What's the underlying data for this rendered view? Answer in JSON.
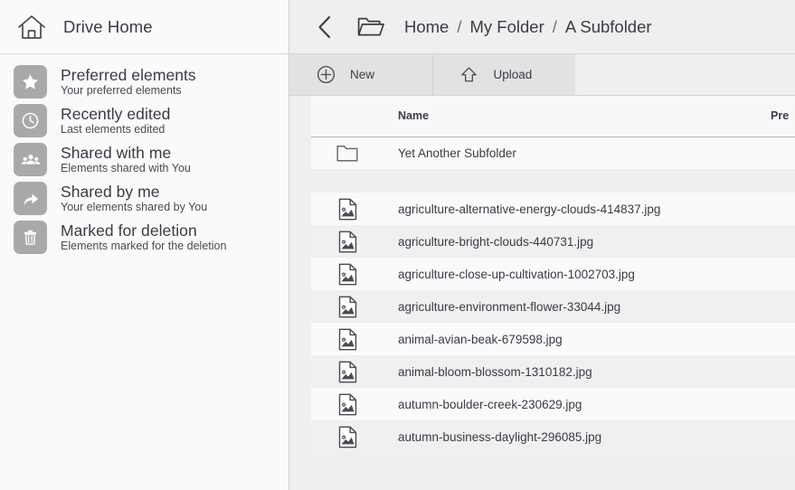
{
  "sidebar": {
    "home": {
      "label": "Drive Home",
      "icon": "home-icon"
    },
    "items": [
      {
        "icon": "star-icon",
        "title": "Preferred elements",
        "subtitle": "Your preferred elements"
      },
      {
        "icon": "clock-icon",
        "title": "Recently edited",
        "subtitle": "Last elements edited"
      },
      {
        "icon": "people-icon",
        "title": "Shared with me",
        "subtitle": "Elements shared with You"
      },
      {
        "icon": "share-arrow-icon",
        "title": "Shared by me",
        "subtitle": "Your elements shared by You"
      },
      {
        "icon": "trash-icon",
        "title": "Marked for deletion",
        "subtitle": "Elements marked for the deletion"
      }
    ]
  },
  "header": {
    "back_icon": "chevron-left-icon",
    "folder_icon": "folder-open-icon",
    "breadcrumbs": [
      "Home",
      "My Folder",
      "A Subfolder"
    ],
    "separator": "/"
  },
  "toolbar": {
    "buttons": [
      {
        "label": "New",
        "icon": "plus-circle-icon"
      },
      {
        "label": "Upload",
        "icon": "upload-arrow-icon"
      }
    ]
  },
  "table": {
    "columns": [
      "",
      "Name",
      "Pre"
    ],
    "rows": [
      {
        "type": "folder",
        "icon": "folder-icon",
        "name": "Yet Another Subfolder"
      },
      {
        "type": "file",
        "icon": "image-file-icon",
        "name": "agriculture-alternative-energy-clouds-414837.jpg"
      },
      {
        "type": "file",
        "icon": "image-file-icon",
        "name": "agriculture-bright-clouds-440731.jpg"
      },
      {
        "type": "file",
        "icon": "image-file-icon",
        "name": "agriculture-close-up-cultivation-1002703.jpg"
      },
      {
        "type": "file",
        "icon": "image-file-icon",
        "name": "agriculture-environment-flower-33044.jpg"
      },
      {
        "type": "file",
        "icon": "image-file-icon",
        "name": "animal-avian-beak-679598.jpg"
      },
      {
        "type": "file",
        "icon": "image-file-icon",
        "name": "animal-bloom-blossom-1310182.jpg"
      },
      {
        "type": "file",
        "icon": "image-file-icon",
        "name": "autumn-boulder-creek-230629.jpg"
      },
      {
        "type": "file",
        "icon": "image-file-icon",
        "name": "autumn-business-daylight-296085.jpg"
      }
    ]
  },
  "colors": {
    "sidebar_bg": "#fafafa",
    "main_bg": "#efefef",
    "icon_tile": "#a9a9a9",
    "row_odd": "#fafafa",
    "row_even": "#f0f0f0",
    "toolbar_group": "#e2e2e2",
    "text": "#3b3b44"
  }
}
